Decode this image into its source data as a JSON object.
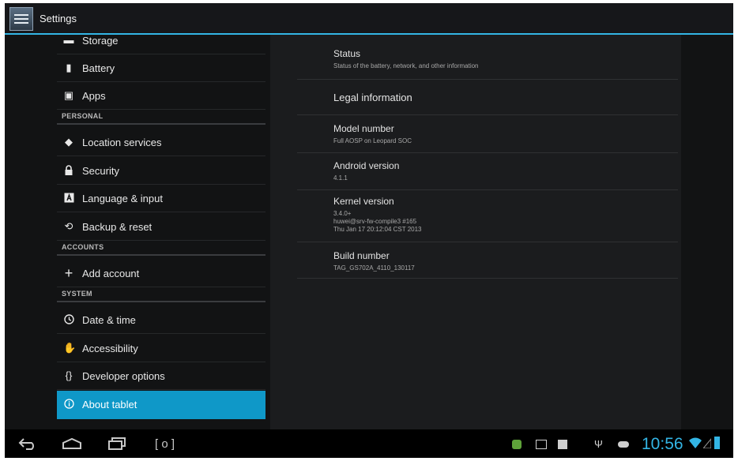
{
  "action_bar": {
    "title": "Settings",
    "icon": "settings-app-icon"
  },
  "sidebar": {
    "items": [
      {
        "label": "Storage",
        "icon": "storage-icon"
      },
      {
        "label": "Battery",
        "icon": "battery-icon"
      },
      {
        "label": "Apps",
        "icon": "apps-icon"
      },
      {
        "label": "Location services",
        "icon": "location-icon"
      },
      {
        "label": "Security",
        "icon": "lock-icon"
      },
      {
        "label": "Language & input",
        "icon": "language-icon"
      },
      {
        "label": "Backup & reset",
        "icon": "backup-icon"
      },
      {
        "label": "Add account",
        "icon": "plus-icon"
      },
      {
        "label": "Date & time",
        "icon": "clock-icon"
      },
      {
        "label": "Accessibility",
        "icon": "hand-icon"
      },
      {
        "label": "Developer options",
        "icon": "braces-icon"
      },
      {
        "label": "About tablet",
        "icon": "info-icon"
      }
    ],
    "sections": {
      "personal": "PERSONAL",
      "accounts": "ACCOUNTS",
      "system": "SYSTEM"
    },
    "selected": "About tablet"
  },
  "about": {
    "status": {
      "title": "Status",
      "summary": "Status of the battery, network, and other information"
    },
    "legal": {
      "title": "Legal information"
    },
    "model": {
      "title": "Model number",
      "value": "Full AOSP on Leopard SOC"
    },
    "android": {
      "title": "Android version",
      "value": "4.1.1"
    },
    "kernel": {
      "title": "Kernel version",
      "line1": "3.4.0+",
      "line2": "huwei@srv-fw-compile3 #165",
      "line3": "Thu Jan 17 20:12:04 CST 2013"
    },
    "build": {
      "title": "Build number",
      "value": "TAG_GS702A_4110_130117"
    }
  },
  "navbar": {
    "back": "back-icon",
    "home": "home-icon",
    "recents": "recents-icon",
    "screenshot": "screenshot-icon"
  },
  "status_bar": {
    "time": "10:56",
    "icons": [
      "android-icon",
      "image-icon",
      "notification-icon",
      "usb-icon",
      "gamepad-icon",
      "wifi-icon",
      "signal-icon",
      "battery-status-icon"
    ]
  },
  "colors": {
    "accent": "#33b5e5",
    "selected": "#0f98c8"
  }
}
